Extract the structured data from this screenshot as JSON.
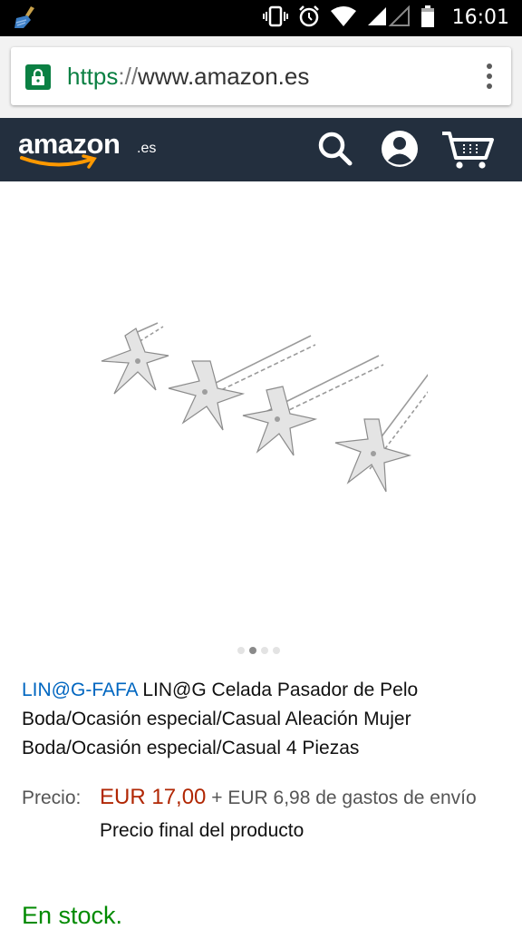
{
  "status_bar": {
    "time": "16:01",
    "icons": [
      "cleaner-broom-icon",
      "vibrate-icon",
      "alarm-icon",
      "wifi-icon",
      "signal-icon",
      "battery-icon"
    ]
  },
  "browser": {
    "url_scheme": "https",
    "url_sep": "://",
    "url_host": "www.amazon.es",
    "menu_icon": "kebab-menu-icon"
  },
  "header": {
    "logo_word": "amazon",
    "logo_tld": ".es",
    "icons": [
      "search-icon",
      "account-icon",
      "cart-icon"
    ],
    "bg_color": "#232f3e",
    "accent_color": "#ff9900"
  },
  "product": {
    "image_alt": "starfish-hair-pins-image",
    "carousel": {
      "count": 4,
      "active_index": 1
    },
    "brand": "LIN@G-FAFA",
    "title": " LIN@G Celada Pasador de Pelo Boda/Ocasión especial/Casual Aleación Mujer Boda/Ocasión especial/Casual 4 Piezas",
    "price_label": "Precio:",
    "price": "EUR 17,00",
    "shipping": " + EUR 6,98 de gastos de envío",
    "price_note": "Precio final del producto",
    "stock": "En stock.",
    "price_color": "#b12704",
    "stock_color": "#008a00",
    "brand_color": "#0066c0"
  }
}
